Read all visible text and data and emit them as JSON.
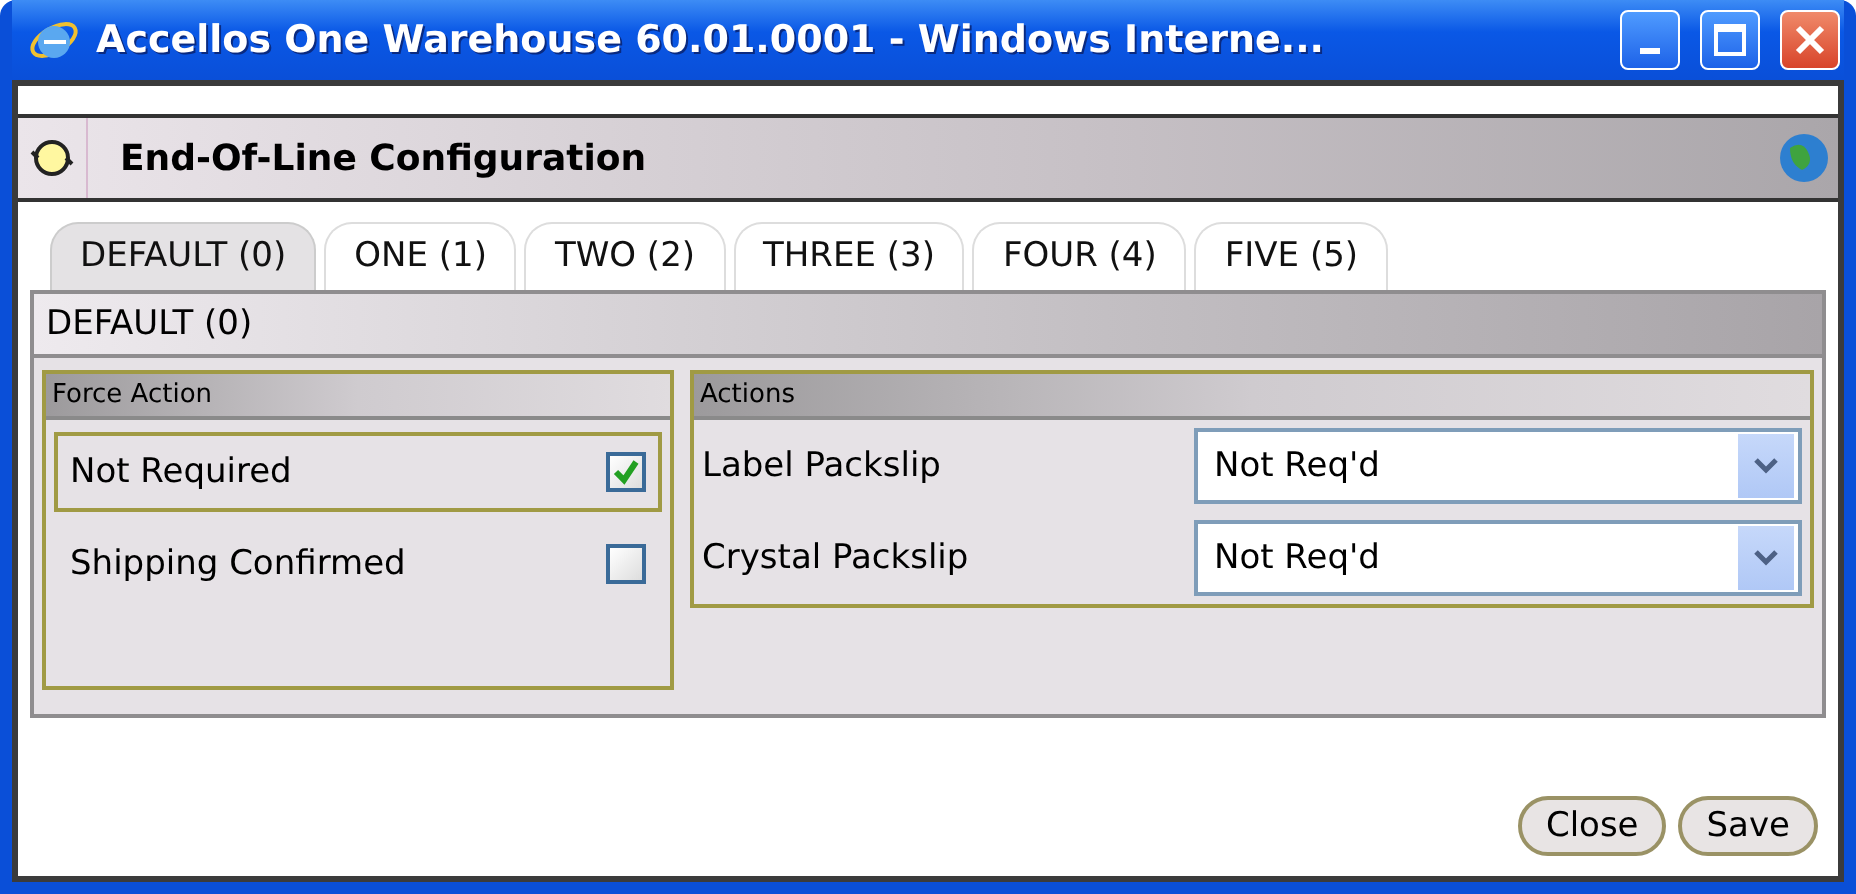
{
  "window": {
    "title": "Accellos One Warehouse 60.01.0001 - Windows Interne..."
  },
  "header": {
    "title": "End-Of-Line Configuration"
  },
  "tabs": [
    {
      "label": "DEFAULT (0)",
      "selected": true
    },
    {
      "label": "ONE (1)",
      "selected": false
    },
    {
      "label": "TWO (2)",
      "selected": false
    },
    {
      "label": "THREE (3)",
      "selected": false
    },
    {
      "label": "FOUR (4)",
      "selected": false
    },
    {
      "label": "FIVE (5)",
      "selected": false
    }
  ],
  "panel": {
    "title": "DEFAULT (0)"
  },
  "force_action": {
    "title": "Force Action",
    "options": [
      {
        "label": "Not Required",
        "checked": true,
        "focused": true
      },
      {
        "label": "Shipping Confirmed",
        "checked": false,
        "focused": false
      }
    ]
  },
  "actions": {
    "title": "Actions",
    "fields": [
      {
        "label": "Label Packslip",
        "value": "Not Req'd"
      },
      {
        "label": "Crystal Packslip",
        "value": "Not Req'd"
      }
    ]
  },
  "buttons": [
    "Close",
    "Save"
  ]
}
